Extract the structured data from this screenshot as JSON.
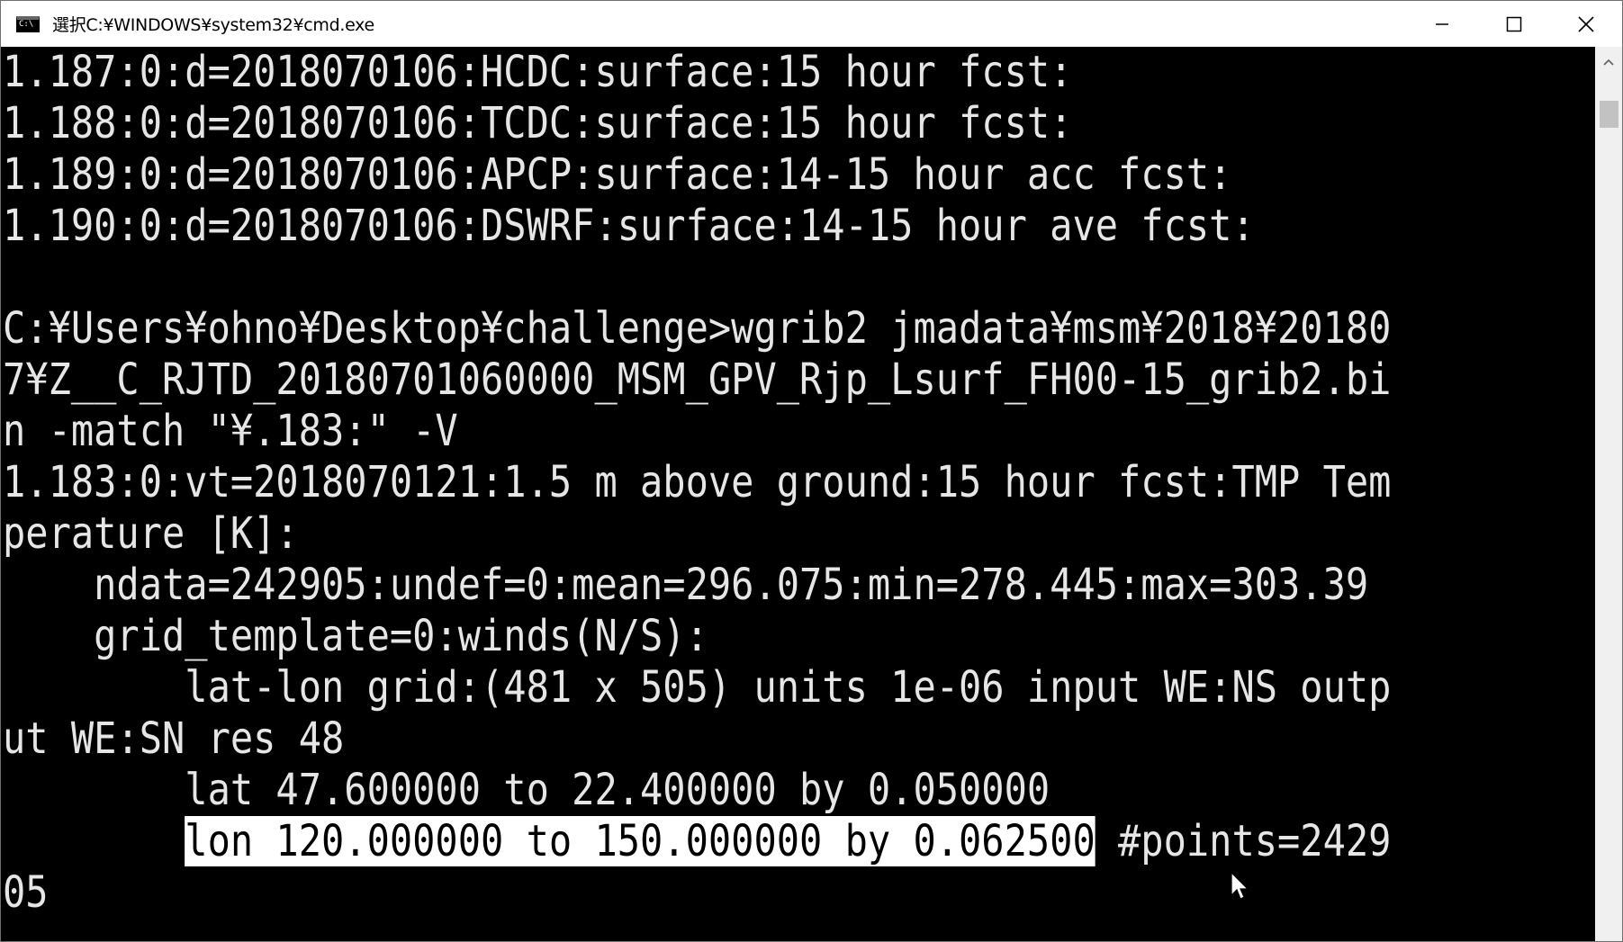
{
  "window": {
    "title": "選択C:¥WINDOWS¥system32¥cmd.exe",
    "icon": "cmd-icon",
    "controls": [
      "minimize-icon",
      "maximize-icon",
      "close-icon"
    ]
  },
  "console": {
    "lines": [
      "1.187:0:d=2018070106:HCDC:surface:15 hour fcst:",
      "1.188:0:d=2018070106:TCDC:surface:15 hour fcst:",
      "1.189:0:d=2018070106:APCP:surface:14-15 hour acc fcst:",
      "1.190:0:d=2018070106:DSWRF:surface:14-15 hour ave fcst:",
      "",
      "C:¥Users¥ohno¥Desktop¥challenge>wgrib2 jmadata¥msm¥2018¥20180",
      "7¥Z__C_RJTD_20180701060000_MSM_GPV_Rjp_Lsurf_FH00-15_grib2.bi",
      "n -match \"¥.183:\" -V",
      "1.183:0:vt=2018070121:1.5 m above ground:15 hour fcst:TMP Tem",
      "perature [K]:",
      "    ndata=242905:undef=0:mean=296.075:min=278.445:max=303.39",
      "    grid_template=0:winds(N/S):",
      "        lat-lon grid:(481 x 505) units 1e-06 input WE:NS outp",
      "ut WE:SN res 48",
      "        lat 47.600000 to 22.400000 by 0.050000"
    ],
    "selected_line": {
      "indent": "        ",
      "selected": "lon 120.000000 to 150.000000 by 0.062500",
      "rest": " #points=2429"
    },
    "last_line": "05"
  },
  "colors": {
    "background": "#000000",
    "text": "#e6e6e6",
    "selection_bg": "#ffffff",
    "selection_fg": "#000000",
    "titlebar": "#ffffff"
  }
}
